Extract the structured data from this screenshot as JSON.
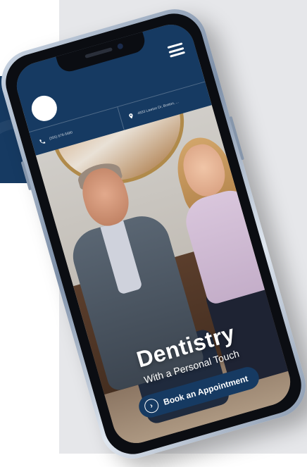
{
  "header": {
    "phone": "(555) 678-5680",
    "address": "4833 Lawton Dr, Boston, ..."
  },
  "hero": {
    "title": "Dentistry",
    "subtitle": "With a Personal Touch",
    "cta_label": "Book an Appointment",
    "cta_icon": "chevron-right-icon"
  },
  "colors": {
    "brand_navy": "#163a62",
    "background_gray": "#e6e7ea",
    "text_white": "#ffffff"
  }
}
